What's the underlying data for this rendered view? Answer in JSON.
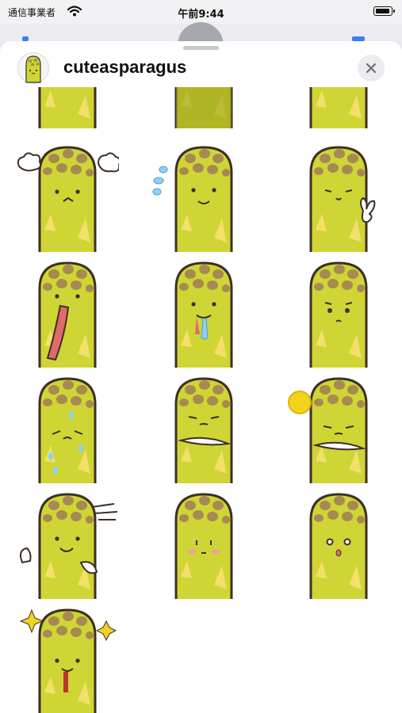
{
  "status_bar": {
    "carrier": "通信事業者",
    "time": "午前9:44",
    "battery_level": 1.0
  },
  "sheet": {
    "title": "cuteasparagus",
    "icon": "asparagus-sticker-icon",
    "close_icon": "close-icon"
  },
  "stickers": [
    "partial-sticker-1",
    "partial-sticker-2",
    "partial-sticker-3",
    "huffing",
    "sweating",
    "peace",
    "tongue-out",
    "drooling",
    "worried",
    "cold-sweat",
    "arms-crossed",
    "arms-crossed-sun",
    "running",
    "blushing",
    "surprised",
    "sparkling"
  ],
  "colors": {
    "asparagus": "#cfd534",
    "tip": "#a68a52",
    "outline": "#3c2f25",
    "highlight": "#f2e06a"
  }
}
